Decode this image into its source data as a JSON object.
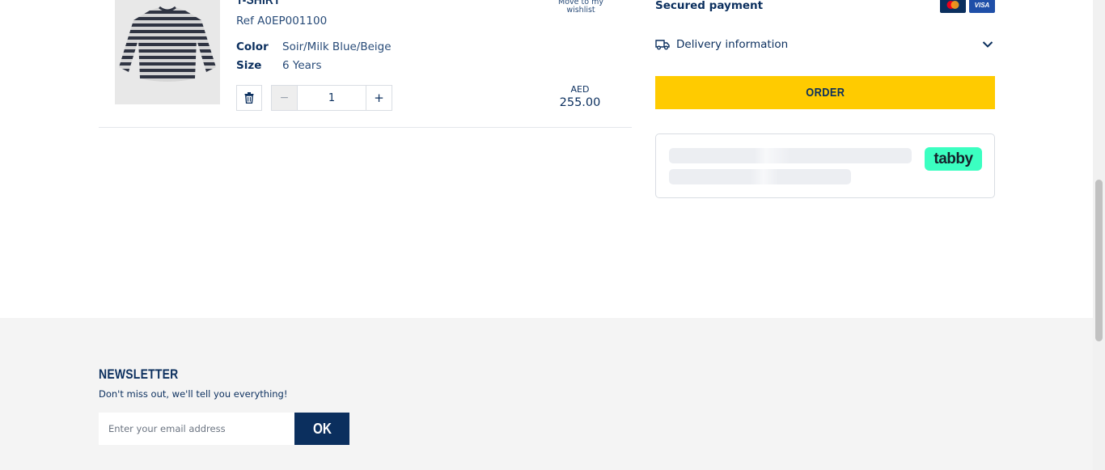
{
  "cart_item": {
    "title": "T-SHIRT",
    "ref": "Ref A0EP001100",
    "color_label": "Color",
    "color_value": "Soir/Milk Blue/Beige",
    "size_label": "Size",
    "size_value": "6 Years",
    "wishlist_label": "Move to my wishlist",
    "quantity": "1",
    "qty_minus": "−",
    "qty_plus": "+",
    "currency": "AED",
    "price": "255.00"
  },
  "summary": {
    "secured_payment": "Secured payment",
    "cards": [
      "mastercard",
      "VISA"
    ],
    "delivery_label": "Delivery information",
    "order_label": "ORDER",
    "tabby_label": "tabby"
  },
  "newsletter": {
    "title": "NEWSLETTER",
    "subtitle": "Don't miss out, we'll tell you everything!",
    "placeholder": "Enter your email address",
    "ok_label": "OK"
  },
  "colors": {
    "navy": "#0b2f5e",
    "yellow": "#ffcb00",
    "tabby_green": "#3bffc1",
    "footer_bg": "#f4f4f4"
  },
  "icons": [
    "trash-icon",
    "truck-icon",
    "chevron-down-icon",
    "mastercard-icon",
    "visa-icon",
    "tshirt-image"
  ]
}
